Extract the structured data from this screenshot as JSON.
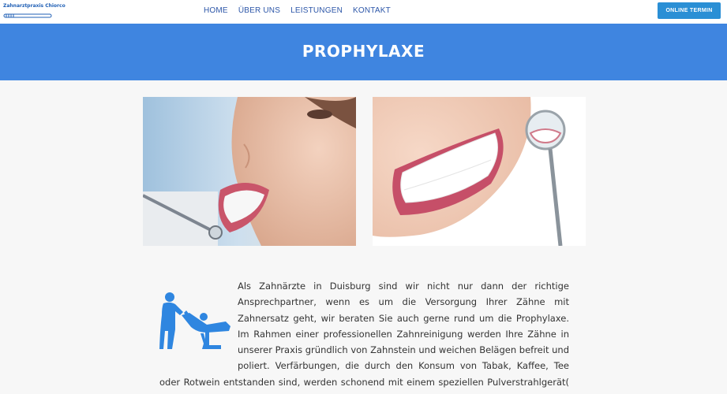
{
  "header": {
    "logo_text": "Zahnarztpraxis Chiorco",
    "nav": [
      {
        "label": "HOME"
      },
      {
        "label": "ÜBER UNS"
      },
      {
        "label": "LEISTUNGEN"
      },
      {
        "label": "KONTAKT"
      }
    ],
    "cta_label": "ONLINE TERMIN"
  },
  "banner": {
    "title": "PROPHYLAXE"
  },
  "images": [
    {
      "alt": "dental-treatment-photo"
    },
    {
      "alt": "smile-with-mirror-photo"
    }
  ],
  "content": {
    "paragraph": "Als Zahnärzte in Duisburg sind wir nicht nur dann der richtige Ansprechpartner, wenn es um die Versorgung Ihrer Zähne mit Zahnersatz geht, wir beraten Sie auch gerne rund um die Prophylaxe. Im Rahmen einer professionellen Zahnreinigung werden Ihre Zähne in unserer Praxis gründlich von Zahnstein und weichen Belägen befreit und poliert. Verfärbungen, die durch den Konsum von Tabak, Kaffee, Tee oder Rotwein entstanden sind, werden schonend mit einem speziellen Pulverstrahlgerät( Air-Flow®) entfernt."
  },
  "colors": {
    "banner": "#3f85e0",
    "cta": "#2a8fd5",
    "nav": "#2c56a8",
    "icon": "#2f86e0"
  }
}
